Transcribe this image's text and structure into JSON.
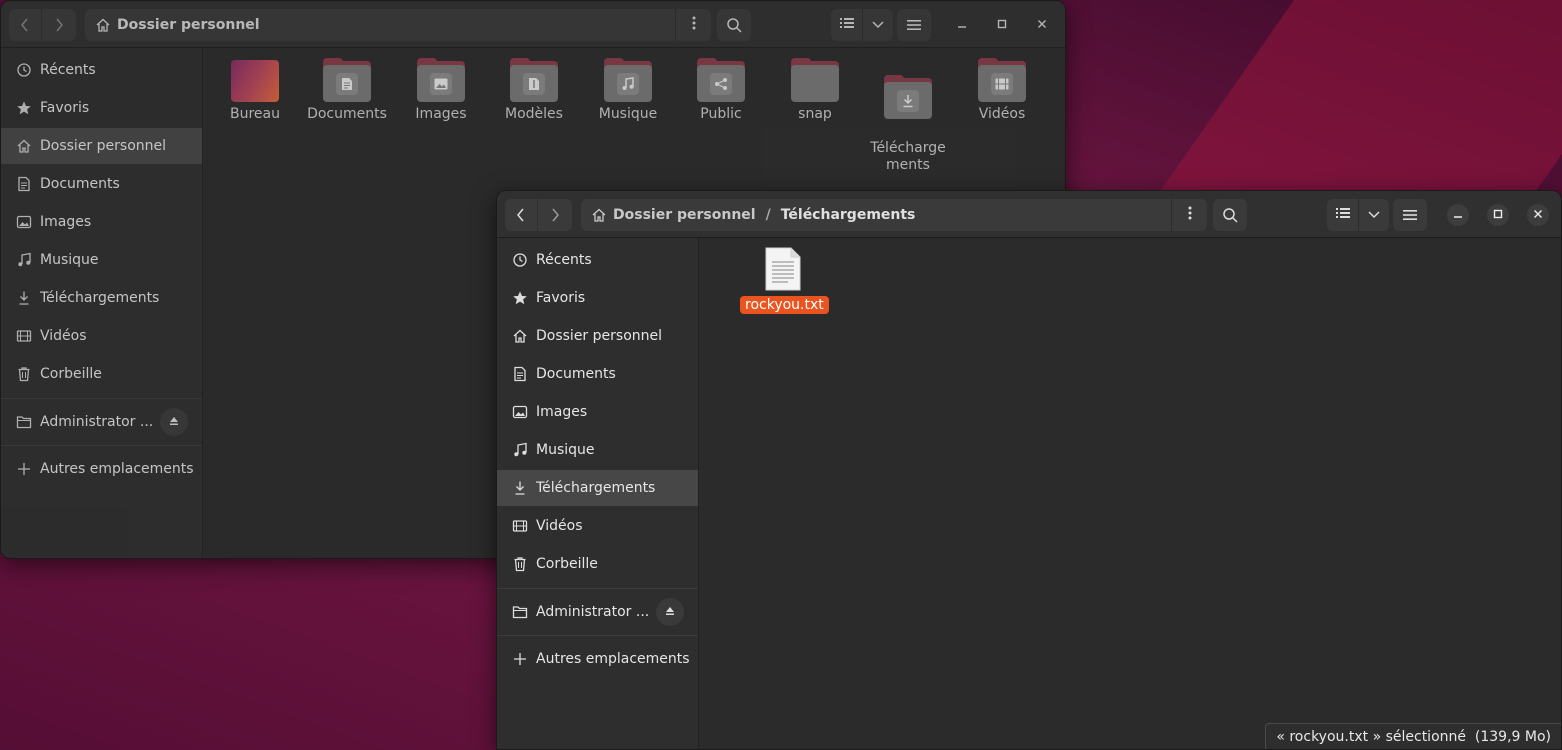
{
  "window1": {
    "path": [
      "Dossier personnel"
    ],
    "sidebar": [
      {
        "label": "Récents",
        "icon": "clock-icon"
      },
      {
        "label": "Favoris",
        "icon": "star-icon"
      },
      {
        "label": "Dossier personnel",
        "icon": "home-icon",
        "active": true
      },
      {
        "label": "Documents",
        "icon": "document-icon"
      },
      {
        "label": "Images",
        "icon": "image-icon"
      },
      {
        "label": "Musique",
        "icon": "music-icon"
      },
      {
        "label": "Téléchargements",
        "icon": "download-icon"
      },
      {
        "label": "Vidéos",
        "icon": "video-icon"
      },
      {
        "label": "Corbeille",
        "icon": "trash-icon"
      }
    ],
    "mount": {
      "label": "Administrator ...",
      "icon": "folder-icon"
    },
    "other_locations": "Autres emplacements",
    "folders": [
      {
        "label": "Bureau",
        "icon": "desktop-folder-icon"
      },
      {
        "label": "Documents",
        "icon": "documents-folder-icon"
      },
      {
        "label": "Images",
        "icon": "pictures-folder-icon"
      },
      {
        "label": "Modèles",
        "icon": "templates-folder-icon"
      },
      {
        "label": "Musique",
        "icon": "music-folder-icon"
      },
      {
        "label": "Public",
        "icon": "public-folder-icon"
      },
      {
        "label": "snap",
        "icon": "folder-icon"
      },
      {
        "label": "Télécharge\nments",
        "icon": "downloads-folder-icon"
      },
      {
        "label": "Vidéos",
        "icon": "videos-folder-icon"
      }
    ]
  },
  "window2": {
    "path": [
      "Dossier personnel",
      "Téléchargements"
    ],
    "path_separator": "/",
    "sidebar": [
      {
        "label": "Récents",
        "icon": "clock-icon"
      },
      {
        "label": "Favoris",
        "icon": "star-icon"
      },
      {
        "label": "Dossier personnel",
        "icon": "home-icon"
      },
      {
        "label": "Documents",
        "icon": "document-icon"
      },
      {
        "label": "Images",
        "icon": "image-icon"
      },
      {
        "label": "Musique",
        "icon": "music-icon"
      },
      {
        "label": "Téléchargements",
        "icon": "download-icon",
        "active": true
      },
      {
        "label": "Vidéos",
        "icon": "video-icon"
      },
      {
        "label": "Corbeille",
        "icon": "trash-icon"
      }
    ],
    "mount": {
      "label": "Administrator ...",
      "icon": "folder-icon"
    },
    "other_locations": "Autres emplacements",
    "files": [
      {
        "label": "rockyou.txt",
        "icon": "text-file-icon",
        "selected": true
      }
    ],
    "status": "« rockyou.txt » sélectionné  (139,9 Mo)"
  },
  "colors": {
    "accent": "#e95420",
    "window_bg": "#2b2b2b",
    "sidebar_bg": "#2e2e2e",
    "active_item": "#474747"
  }
}
